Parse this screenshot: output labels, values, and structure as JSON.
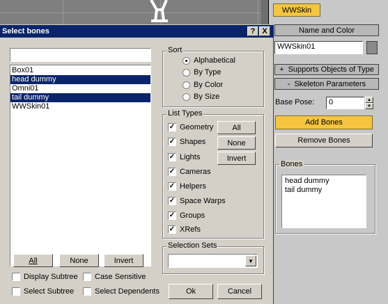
{
  "command_panel": {
    "modifier_name": "WWSkin",
    "name_and_color_label": "Name and Color",
    "object_name": "WWSkin01",
    "object_color": "#8a8a8a",
    "rollouts": [
      "Supports Objects of Type",
      "Skeleton Parameters"
    ],
    "base_pose_label": "Base Pose:",
    "base_pose_value": "0",
    "add_bones_label": "Add Bones",
    "remove_bones_label": "Remove Bones",
    "bones_group_label": "Bones",
    "bones_list": [
      "head dummy",
      "tail dummy"
    ]
  },
  "dialog": {
    "title": "Select bones",
    "help_icon": "?",
    "close_icon": "X",
    "filter_value": "",
    "objects": [
      {
        "name": "Box01",
        "selected": false
      },
      {
        "name": "head dummy",
        "selected": true
      },
      {
        "name": "Omni01",
        "selected": false
      },
      {
        "name": "tail dummy",
        "selected": true
      },
      {
        "name": "WWSkin01",
        "selected": false
      }
    ],
    "list_buttons": {
      "all": "All",
      "none": "None",
      "invert": "Invert"
    },
    "options": {
      "display_subtree": "Display Subtree",
      "case_sensitive": "Case Sensitive",
      "select_subtree": "Select Subtree",
      "select_dependents": "Select Dependents"
    },
    "sort": {
      "label": "Sort",
      "options": [
        "Alphabetical",
        "By Type",
        "By Color",
        "By Size"
      ],
      "selected": "Alphabetical"
    },
    "list_types": {
      "label": "List Types",
      "types": [
        "Geometry",
        "Shapes",
        "Lights",
        "Cameras",
        "Helpers",
        "Space Warps",
        "Groups",
        "XRefs"
      ],
      "all_label": "All",
      "none_label": "None",
      "invert_label": "Invert"
    },
    "selection_sets": {
      "label": "Selection Sets",
      "value": ""
    },
    "ok_label": "Ok",
    "cancel_label": "Cancel"
  }
}
